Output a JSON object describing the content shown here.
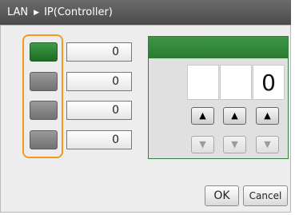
{
  "title": {
    "segment1": "LAN",
    "separator": "▶",
    "segment2": "IP(Controller)"
  },
  "octets": [
    {
      "value": "0",
      "active": true
    },
    {
      "value": "0",
      "active": false
    },
    {
      "value": "0",
      "active": false
    },
    {
      "value": "0",
      "active": false
    }
  ],
  "editor": {
    "digits": [
      "",
      "",
      "0"
    ],
    "up_glyph": "▲",
    "down_glyph": "▼"
  },
  "buttons": {
    "ok": "OK",
    "cancel": "Cancel"
  },
  "colors": {
    "accent_green": "#2f8a36",
    "selector_orange": "#f39a1e",
    "titlebar": "#555555"
  }
}
